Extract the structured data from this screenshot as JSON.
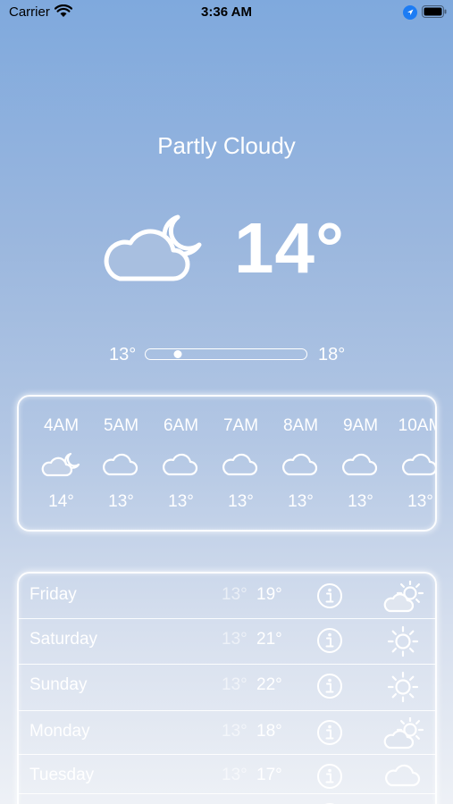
{
  "status_bar": {
    "carrier": "Carrier",
    "time": "3:36 AM",
    "icons": [
      "wifi-icon",
      "location-arrow-icon",
      "battery-icon"
    ]
  },
  "current": {
    "condition": "Partly Cloudy",
    "temperature": "14°",
    "icon": "cloud-moon-icon",
    "range_low": "13°",
    "range_high": "18°",
    "range_position_fraction": 0.2
  },
  "hourly": [
    {
      "time": "4AM",
      "temp": "14°",
      "icon": "cloud-moon-icon"
    },
    {
      "time": "5AM",
      "temp": "13°",
      "icon": "cloud-icon"
    },
    {
      "time": "6AM",
      "temp": "13°",
      "icon": "cloud-icon"
    },
    {
      "time": "7AM",
      "temp": "13°",
      "icon": "cloud-icon"
    },
    {
      "time": "8AM",
      "temp": "13°",
      "icon": "cloud-icon"
    },
    {
      "time": "9AM",
      "temp": "13°",
      "icon": "cloud-icon"
    },
    {
      "time": "10AM",
      "temp": "13°",
      "icon": "cloud-icon"
    }
  ],
  "daily": [
    {
      "day": "Friday",
      "low": "13°",
      "high": "19°",
      "icon": "cloud-sun-icon"
    },
    {
      "day": "Saturday",
      "low": "13°",
      "high": "21°",
      "icon": "sun-icon"
    },
    {
      "day": "Sunday",
      "low": "13°",
      "high": "22°",
      "icon": "sun-icon"
    },
    {
      "day": "Monday",
      "low": "13°",
      "high": "18°",
      "icon": "cloud-sun-icon"
    },
    {
      "day": "Tuesday",
      "low": "13°",
      "high": "17°",
      "icon": "cloud-icon"
    }
  ]
}
